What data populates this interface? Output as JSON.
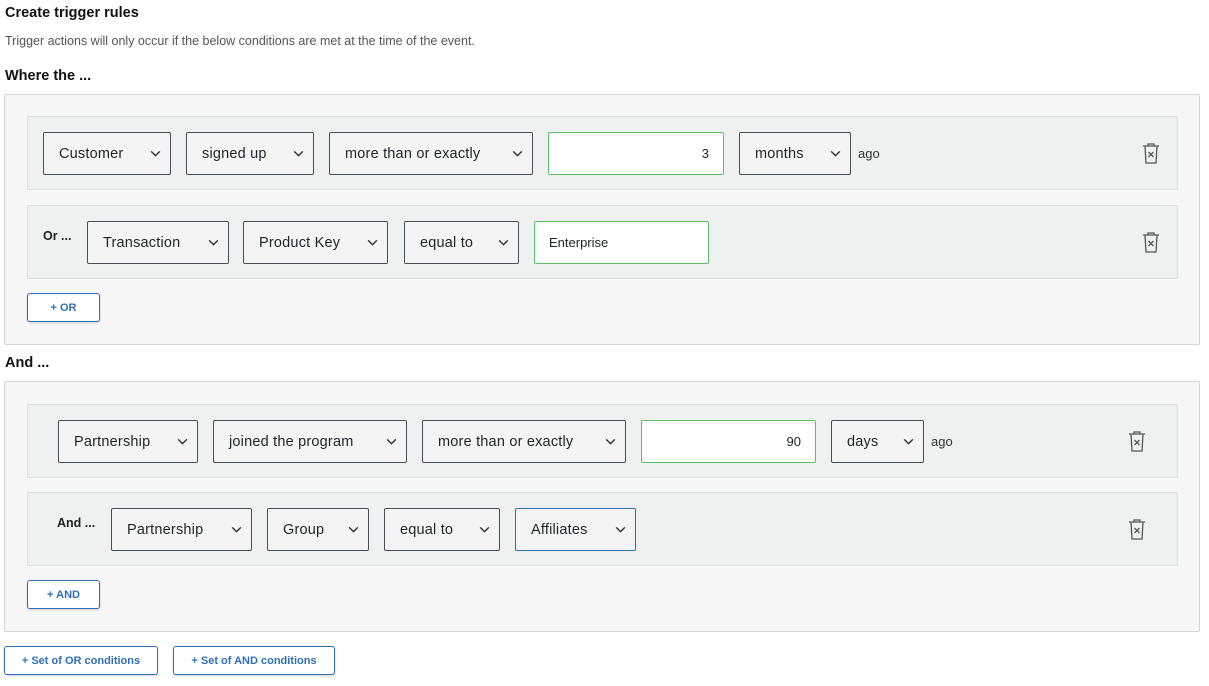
{
  "header": {
    "title": "Create trigger rules",
    "subtitle": "Trigger actions will only occur if the below conditions are met at the time of the event."
  },
  "or_section": {
    "label": "Where the ...",
    "rows": [
      {
        "prefix": "",
        "entity": "Customer",
        "field": "signed up",
        "operator": "more than or exactly",
        "value": "3",
        "unit": "months",
        "suffix": "ago"
      },
      {
        "prefix": "Or ...",
        "entity": "Transaction",
        "field": "Product Key",
        "operator": "equal to",
        "value": "Enterprise"
      }
    ],
    "add_label": "+ OR"
  },
  "and_section": {
    "label": "And ...",
    "rows": [
      {
        "prefix": "",
        "entity": "Partnership",
        "field": "joined the program",
        "operator": "more than or exactly",
        "value": "90",
        "unit": "days",
        "suffix": "ago"
      },
      {
        "prefix": "And ...",
        "entity": "Partnership",
        "field": "Group",
        "operator": "equal to",
        "value": "Affiliates"
      }
    ],
    "add_label": "+ AND"
  },
  "footer": {
    "or_set_label": "+ Set of OR conditions",
    "and_set_label": "+ Set of AND conditions"
  },
  "colors": {
    "accent": "#2f6fb8",
    "input_border_valid": "#5cbf6a"
  },
  "icons": {
    "dropdown": "chevron-down-icon",
    "delete": "trash-icon"
  }
}
